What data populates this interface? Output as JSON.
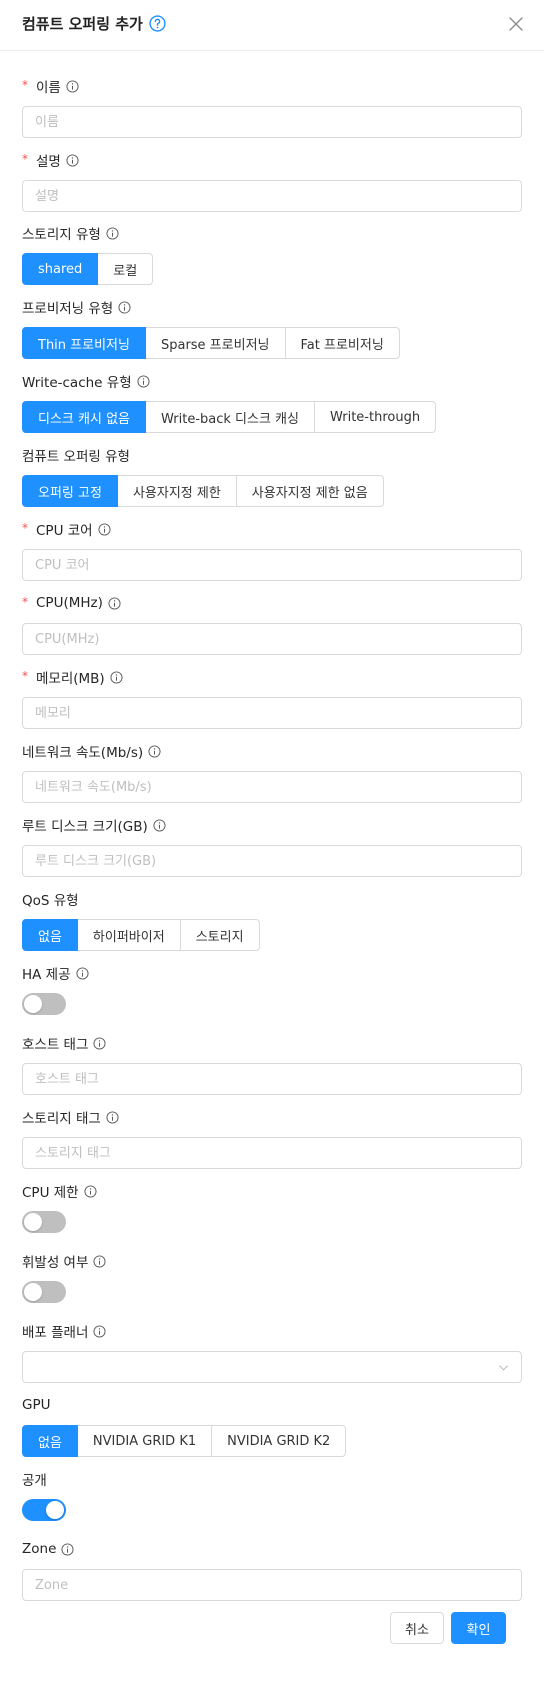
{
  "dialog": {
    "title": "컴퓨트 오퍼링 추가"
  },
  "fields": {
    "name": {
      "label": "이름",
      "placeholder": "이름"
    },
    "description": {
      "label": "설명",
      "placeholder": "설명"
    },
    "storage_type": {
      "label": "스토리지 유형",
      "options": [
        "shared",
        "로컬"
      ],
      "selected": "shared"
    },
    "provisioning_type": {
      "label": "프로비저닝 유형",
      "options": [
        "Thin 프로비저닝",
        "Sparse 프로비저닝",
        "Fat 프로비저닝"
      ],
      "selected": "Thin 프로비저닝"
    },
    "write_cache_type": {
      "label": "Write-cache 유형",
      "options": [
        "디스크 캐시 없음",
        "Write-back 디스크 캐싱",
        "Write-through"
      ],
      "selected": "디스크 캐시 없음"
    },
    "offering_type": {
      "label": "컴퓨트 오퍼링 유형",
      "options": [
        "오퍼링 고정",
        "사용자지정 제한",
        "사용자지정 제한 없음"
      ],
      "selected": "오퍼링 고정"
    },
    "cpu_cores": {
      "label": "CPU 코어",
      "placeholder": "CPU 코어"
    },
    "cpu_mhz": {
      "label": "CPU(MHz)",
      "placeholder": "CPU(MHz)"
    },
    "memory": {
      "label": "메모리(MB)",
      "placeholder": "메모리"
    },
    "network_rate": {
      "label": "네트워크 속도(Mb/s)",
      "placeholder": "네트워크 속도(Mb/s)"
    },
    "root_disk_size": {
      "label": "루트 디스크 크기(GB)",
      "placeholder": "루트 디스크 크기(GB)"
    },
    "qos_type": {
      "label": "QoS 유형",
      "options": [
        "없음",
        "하이퍼바이저",
        "스토리지"
      ],
      "selected": "없음"
    },
    "ha": {
      "label": "HA 제공",
      "on": false
    },
    "host_tags": {
      "label": "호스트 태그",
      "placeholder": "호스트 태그"
    },
    "storage_tags": {
      "label": "스토리지 태그",
      "placeholder": "스토리지 태그"
    },
    "cpu_limit": {
      "label": "CPU 제한",
      "on": false
    },
    "volatile": {
      "label": "휘발성 여부",
      "on": false
    },
    "deployment_planner": {
      "label": "배포 플래너",
      "value": ""
    },
    "gpu": {
      "label": "GPU",
      "options": [
        "없음",
        "NVIDIA GRID K1",
        "NVIDIA GRID K2"
      ],
      "selected": "없음"
    },
    "public": {
      "label": "공개",
      "on": true
    },
    "zone": {
      "label": "Zone",
      "placeholder": "Zone"
    }
  },
  "footer": {
    "cancel_label": "취소",
    "ok_label": "확인"
  },
  "icons": {
    "title_help": "question-circle-icon",
    "close": "close-icon",
    "field_info": "info-circle-icon",
    "select_arrow": "chevron-down-icon"
  },
  "colors": {
    "primary": "#1e90ff",
    "required": "#ff4d4f",
    "toggle_off": "#bfbfbf"
  }
}
